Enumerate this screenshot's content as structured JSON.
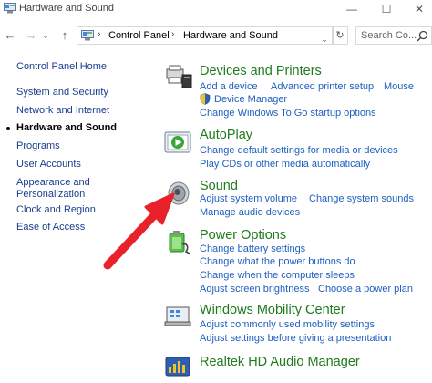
{
  "window": {
    "title": "Hardware and Sound",
    "minimize": "—",
    "maximize": "☐",
    "close": "✕"
  },
  "nav": {
    "back": "←",
    "forward": "→",
    "recent": "⌄",
    "up": "↑",
    "breadcrumbs": [
      "Control Panel",
      "Hardware and Sound"
    ],
    "crumb_sep": "›",
    "dropdown": "⌄",
    "refresh": "↻",
    "search_placeholder": "Search Co..."
  },
  "sidebar": {
    "items": [
      {
        "label": "Control Panel Home"
      },
      {
        "label": "System and Security"
      },
      {
        "label": "Network and Internet"
      },
      {
        "label": "Hardware and Sound"
      },
      {
        "label": "Programs"
      },
      {
        "label": "User Accounts"
      },
      {
        "label": "Appearance and"
      },
      {
        "label": "Personalization"
      },
      {
        "label": "Clock and Region"
      },
      {
        "label": "Ease of Access"
      }
    ]
  },
  "categories": {
    "devices": {
      "title": "Devices and Printers",
      "links": [
        "Add a device",
        "Advanced printer setup",
        "Mouse",
        "Device Manager",
        "Change Windows To Go startup options"
      ]
    },
    "autoplay": {
      "title": "AutoPlay",
      "links": [
        "Change default settings for media or devices",
        "Play CDs or other media automatically"
      ]
    },
    "sound": {
      "title": "Sound",
      "links": [
        "Adjust system volume",
        "Change system sounds",
        "Manage audio devices"
      ]
    },
    "power": {
      "title": "Power Options",
      "links": [
        "Change battery settings",
        "Change what the power buttons do",
        "Change when the computer sleeps",
        "Adjust screen brightness",
        "Choose a power plan"
      ]
    },
    "mobility": {
      "title": "Windows Mobility Center",
      "links": [
        "Adjust commonly used mobility settings",
        "Adjust settings before giving a presentation"
      ]
    },
    "realtek": {
      "title": "Realtek HD Audio Manager"
    }
  },
  "colors": {
    "category_title": "#1e7b1e",
    "link": "#1f5fbf",
    "nav_link": "#1a3e8c",
    "annotation_arrow": "#e8212b"
  }
}
